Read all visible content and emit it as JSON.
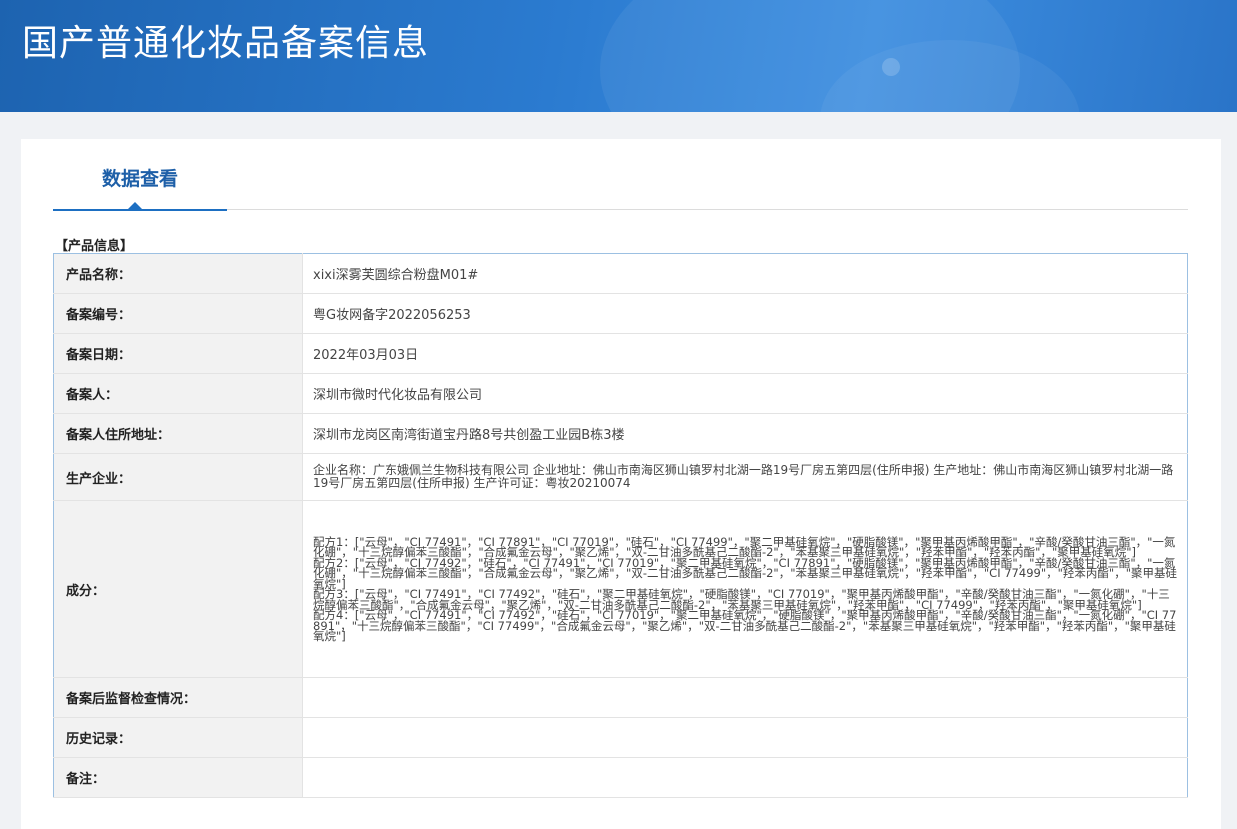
{
  "header": {
    "title": "国产普通化妆品备案信息"
  },
  "tabs": [
    {
      "label": "数据查看"
    }
  ],
  "section": {
    "title": "【产品信息】"
  },
  "rows": {
    "product_name": {
      "label": "产品名称：",
      "value": "xixi深雾芙圆综合粉盘M01#"
    },
    "record_no": {
      "label": "备案编号：",
      "value": "粤G妆网备字2022056253"
    },
    "record_date": {
      "label": "备案日期：",
      "value": "2022年03月03日"
    },
    "registrant": {
      "label": "备案人：",
      "value": "深圳市微时代化妆品有限公司"
    },
    "registrant_address": {
      "label": "备案人住所地址：",
      "value": "深圳市龙岗区南湾街道宝丹路8号共创盈工业园B栋3楼"
    },
    "manufacturer": {
      "label": "生产企业：",
      "value": "企业名称：广东娥佩兰生物科技有限公司 企业地址：佛山市南海区狮山镇罗村北湖一路19号厂房五第四层(住所申报) 生产地址：佛山市南海区狮山镇罗村北湖一路19号厂房五第四层(住所申报) 生产许可证：粤妆20210074"
    },
    "ingredients": {
      "label": "成分：",
      "formulas": [
        "配方1：[\"云母\"，\"CI 77491\"，\"CI 77891\"，\"CI 77019\"，\"硅石\"，\"CI 77499\"，\"聚二甲基硅氧烷\"，\"硬脂酸镁\"，\"聚甲基丙烯酸甲酯\"，\"辛酸/癸酸甘油三酯\"，\"一氮化硼\"，\"十三烷醇偏苯三酸酯\"，\"合成氟金云母\"，\"聚乙烯\"，\"双-二甘油多酰基己二酸酯-2\"，\"苯基聚三甲基硅氧烷\"，\"羟苯甲酯\"，\"羟苯丙酯\"，\"聚甲基硅氧烷\"]",
        "配方2：[\"云母\"，\"CI 77492\"，\"硅石\"，\"CI 77491\"，\"CI 77019\"，\"聚二甲基硅氧烷\"，\"CI 77891\"，\"硬脂酸镁\"，\"聚甲基丙烯酸甲酯\"，\"辛酸/癸酸甘油三酯\"，\"一氮化硼\"，\"十三烷醇偏苯三酸酯\"，\"合成氟金云母\"，\"聚乙烯\"，\"双-二甘油多酰基己二酸酯-2\"，\"苯基聚三甲基硅氧烷\"，\"羟苯甲酯\"，\"CI 77499\"，\"羟苯丙酯\"，\"聚甲基硅氧烷\"]",
        "配方3：[\"云母\"，\"CI 77491\"，\"CI 77492\"，\"硅石\"，\"聚二甲基硅氧烷\"，\"硬脂酸镁\"，\"CI 77019\"，\"聚甲基丙烯酸甲酯\"，\"辛酸/癸酸甘油三酯\"，\"一氮化硼\"，\"十三烷醇偏苯三酸酯\"，\"合成氟金云母\"，\"聚乙烯\"，\"双-二甘油多酰基己二酸酯-2\"，\"苯基聚三甲基硅氧烷\"，\"羟苯甲酯\"，\"CI 77499\"，\"羟苯丙酯\"，\"聚甲基硅氧烷\"]",
        "配方4：[\"云母\"，\"CI 77491\"，\"CI 77492\"，\"硅石\"，\"CI 77019\"，\"聚二甲基硅氧烷\"，\"硬脂酸镁\"，\"聚甲基丙烯酸甲酯\"，\"辛酸/癸酸甘油三酯\"，\"一氮化硼\"，\"CI 77891\"，\"十三烷醇偏苯三酸酯\"，\"CI 77499\"，\"合成氟金云母\"，\"聚乙烯\"，\"双-二甘油多酰基己二酸酯-2\"，\"苯基聚三甲基硅氧烷\"，\"羟苯甲酯\"，\"羟苯丙酯\"，\"聚甲基硅氧烷\"]"
      ]
    },
    "post_inspection": {
      "label": "备案后监督检查情况：",
      "value": ""
    },
    "history": {
      "label": "历史记录：",
      "value": ""
    },
    "remarks": {
      "label": "备注：",
      "value": ""
    }
  },
  "colors": {
    "banner": "#2b7bd0",
    "tab_accent": "#1d6fc2",
    "tab_text": "#1d5fa8",
    "table_border": "#9cc0e2"
  }
}
